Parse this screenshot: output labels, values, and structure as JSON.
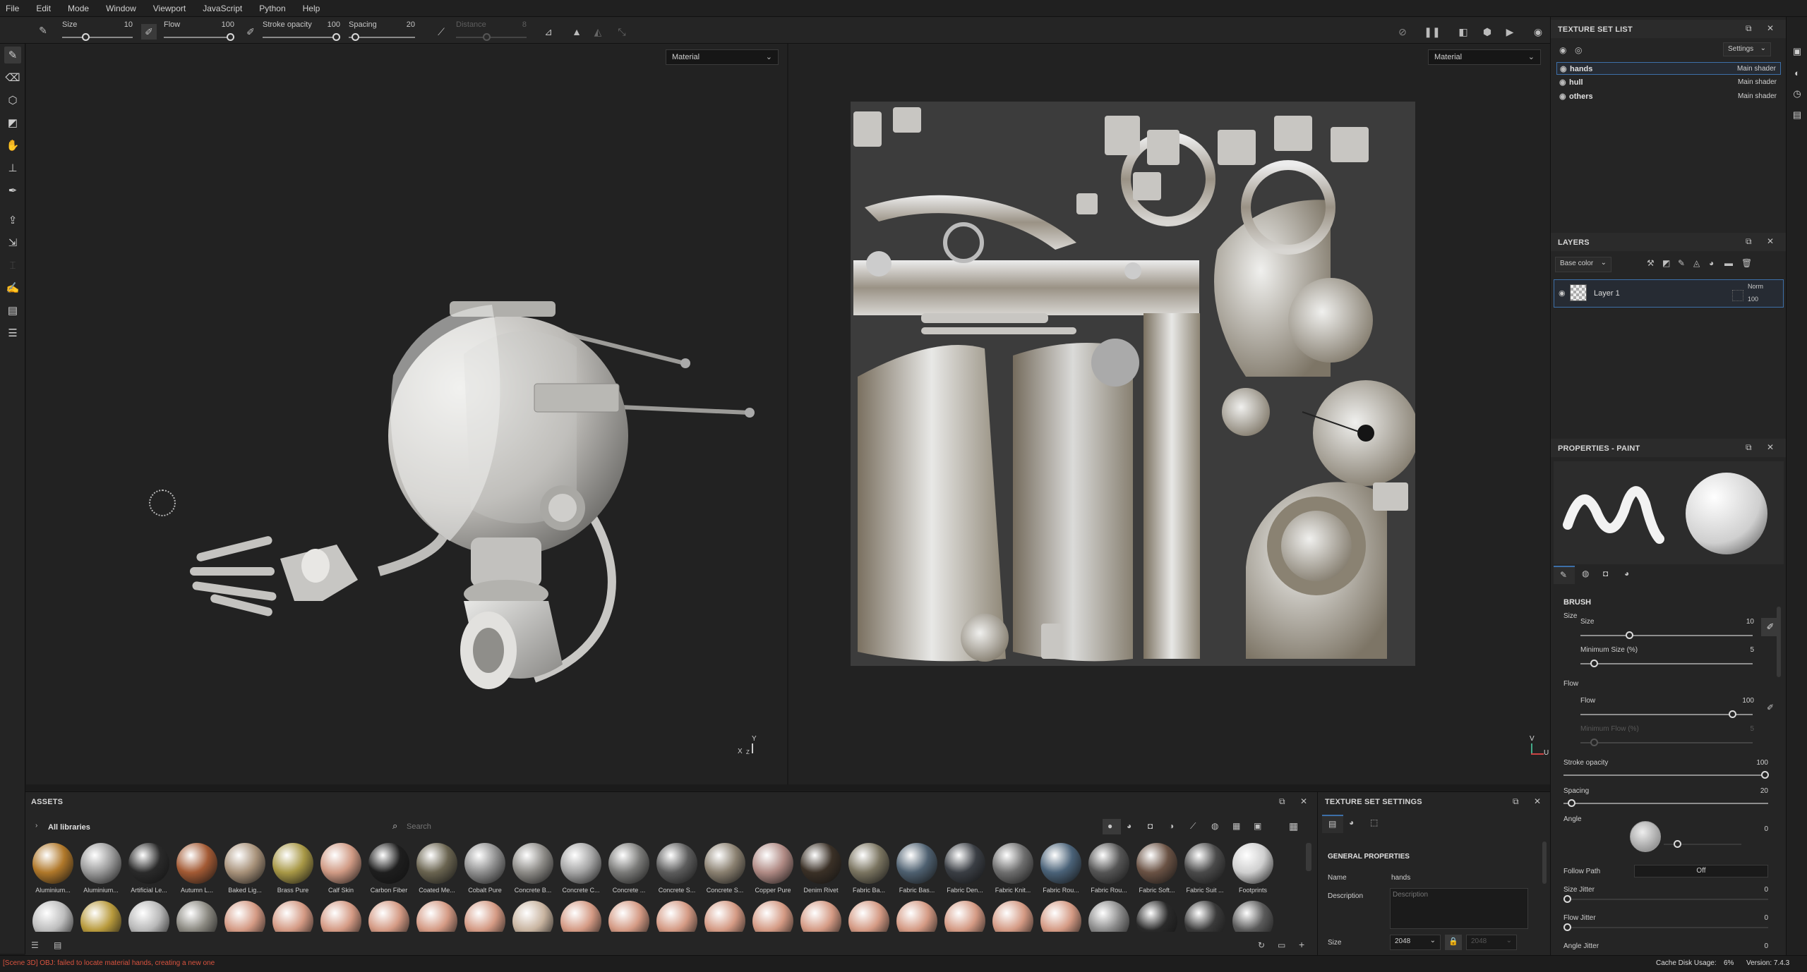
{
  "menu": [
    "File",
    "Edit",
    "Mode",
    "Window",
    "Viewport",
    "JavaScript",
    "Python",
    "Help"
  ],
  "toolbar": {
    "size_label": "Size",
    "size_value": "10",
    "flow_label": "Flow",
    "flow_value": "100",
    "stroke_opacity_label": "Stroke opacity",
    "stroke_opacity_value": "100",
    "spacing_label": "Spacing",
    "spacing_value": "20",
    "distance_label": "Distance",
    "distance_value": "8"
  },
  "viewport3d": {
    "material_select": "Material",
    "axis_x": "X",
    "axis_y": "Y",
    "axis_z": "Z"
  },
  "viewport2d": {
    "material_select": "Material",
    "axis_v": "V",
    "axis_u": "U"
  },
  "texture_set_list": {
    "title": "TEXTURE SET LIST",
    "settings_label": "Settings",
    "rows": [
      {
        "name": "hands",
        "shader": "Main shader",
        "selected": true
      },
      {
        "name": "hull",
        "shader": "Main shader",
        "selected": false
      },
      {
        "name": "others",
        "shader": "Main shader",
        "selected": false
      }
    ]
  },
  "layers": {
    "title": "LAYERS",
    "channel_select": "Base color",
    "layer_name": "Layer 1",
    "blend_mode": "Norm",
    "opacity": "100"
  },
  "properties": {
    "title": "PROPERTIES - PAINT",
    "section": "BRUSH",
    "size_group": "Size",
    "size_label": "Size",
    "size_value": "10",
    "min_size_label": "Minimum Size (%)",
    "min_size_value": "5",
    "flow_group": "Flow",
    "flow_label": "Flow",
    "flow_value": "100",
    "min_flow_label": "Minimum Flow (%)",
    "min_flow_value": "5",
    "stroke_opacity_label": "Stroke opacity",
    "stroke_opacity_value": "100",
    "spacing_label": "Spacing",
    "spacing_value": "20",
    "angle_label": "Angle",
    "angle_value": "0",
    "follow_path_label": "Follow Path",
    "follow_path_value": "Off",
    "size_jitter_label": "Size Jitter",
    "size_jitter_value": "0",
    "flow_jitter_label": "Flow Jitter",
    "flow_jitter_value": "0",
    "angle_jitter_label": "Angle Jitter",
    "angle_jitter_value": "0"
  },
  "assets": {
    "title": "ASSETS",
    "library": "All libraries",
    "search_placeholder": "Search",
    "row1": [
      {
        "label": "Aluminium...",
        "color": "#b0782a"
      },
      {
        "label": "Aluminium...",
        "color": "#9a9a9a"
      },
      {
        "label": "Artificial Le...",
        "color": "#2a2a2a"
      },
      {
        "label": "Autumn L...",
        "color": "#a35a34"
      },
      {
        "label": "Baked Lig...",
        "color": "#a8927a"
      },
      {
        "label": "Brass Pure",
        "color": "#a89846"
      },
      {
        "label": "Calf Skin",
        "color": "#d09a84"
      },
      {
        "label": "Carbon Fiber",
        "color": "#1e1e1e"
      },
      {
        "label": "Coated Me...",
        "color": "#6a6450"
      },
      {
        "label": "Cobalt Pure",
        "color": "#8e8e8e"
      },
      {
        "label": "Concrete B...",
        "color": "#8c8a86"
      },
      {
        "label": "Concrete C...",
        "color": "#a4a4a4"
      },
      {
        "label": "Concrete ...",
        "color": "#7a7a78"
      },
      {
        "label": "Concrete S...",
        "color": "#5c5c5c"
      },
      {
        "label": "Concrete S...",
        "color": "#8a8070"
      },
      {
        "label": "Copper Pure",
        "color": "#b08a84"
      },
      {
        "label": "Denim Rivet",
        "color": "#3a3026"
      },
      {
        "label": "Fabric Ba...",
        "color": "#7a7460"
      },
      {
        "label": "Fabric Bas...",
        "color": "#4e6070"
      },
      {
        "label": "Fabric Den...",
        "color": "#3a3e44"
      },
      {
        "label": "Fabric Knit...",
        "color": "#6e6e6e"
      },
      {
        "label": "Fabric Rou...",
        "color": "#4a6278"
      },
      {
        "label": "Fabric Rou...",
        "color": "#555"
      },
      {
        "label": "Fabric Soft...",
        "color": "#6a5244"
      },
      {
        "label": "Fabric Suit ...",
        "color": "#4a4a4a"
      },
      {
        "label": "Footprints",
        "color": "#cfcfcf"
      }
    ],
    "row2": [
      "#bdbdbd",
      "#b89a3c",
      "#b8b8b8",
      "#8a8880",
      "#d49a84",
      "#d49a84",
      "#d49a84",
      "#d49a84",
      "#d49a84",
      "#d49a84",
      "#c8b4a0",
      "#d49a84",
      "#d49a84",
      "#d49a84",
      "#d49a84",
      "#d49a84",
      "#d49a84",
      "#d49a84",
      "#d49a84",
      "#d49a84",
      "#d49a84",
      "#d49a84",
      "#8a8a8a",
      "#2a2a2a",
      "#3a3a3a",
      "#5a5a5a"
    ]
  },
  "texture_set_settings": {
    "title": "TEXTURE SET SETTINGS",
    "section": "GENERAL PROPERTIES",
    "name_label": "Name",
    "name_value": "hands",
    "description_label": "Description",
    "description_placeholder": "Description",
    "size_label": "Size",
    "size_value": "2048",
    "size_value2": "2048"
  },
  "status": {
    "message": "[Scene 3D] OBJ: failed to locate material hands, creating a new one",
    "cache": "Cache Disk Usage:",
    "cache_value": "6%",
    "version": "Version: 7.4.3"
  },
  "colors": {
    "accent": "#3d6fa8",
    "error": "#d9533f"
  }
}
